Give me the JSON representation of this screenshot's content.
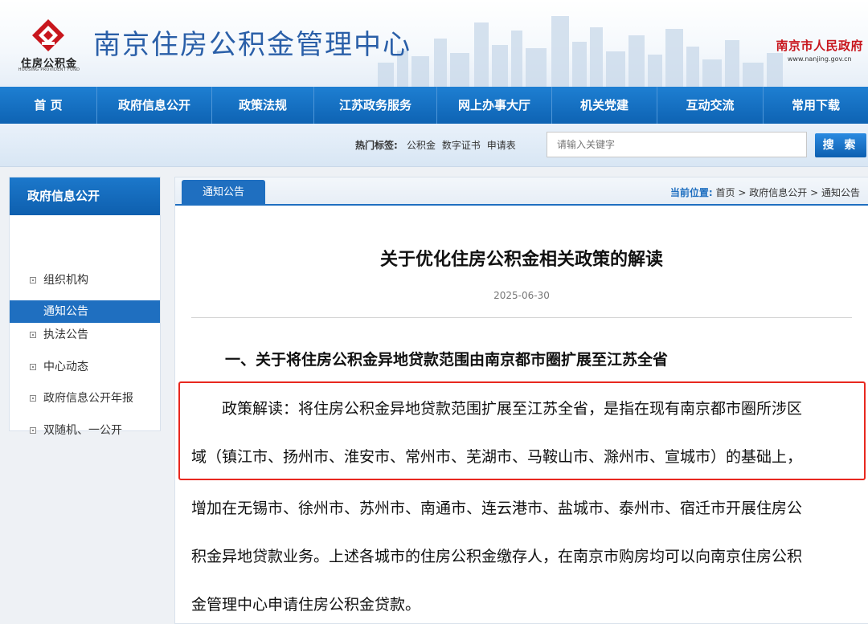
{
  "header": {
    "logo_text": "住房公积金",
    "logo_sub": "HOUSING PROVIDENT FUND",
    "site_title": "南京住房公积金管理中心",
    "gov_name": "南京市人民政府",
    "gov_url": "www.nanjing.gov.cn",
    "brand_color": "#c8161d"
  },
  "nav": {
    "items": [
      {
        "label": "首 页"
      },
      {
        "label": "政府信息公开"
      },
      {
        "label": "政策法规"
      },
      {
        "label": "江苏政务服务"
      },
      {
        "label": "网上办事大厅"
      },
      {
        "label": "机关党建"
      },
      {
        "label": "互动交流"
      },
      {
        "label": "常用下载"
      }
    ],
    "color": "#1170c4"
  },
  "search": {
    "hot_label": "热门标签:",
    "tags": [
      "公积金",
      "数字证书",
      "申请表"
    ],
    "placeholder": "请输入关键字",
    "button": "搜 索"
  },
  "sidebar": {
    "title": "政府信息公开",
    "items": [
      {
        "label": "组织机构",
        "active": false
      },
      {
        "label": "通知公告",
        "active": true
      },
      {
        "label": "执法公告",
        "active": false
      },
      {
        "label": "中心动态",
        "active": false
      },
      {
        "label": "政府信息公开年报",
        "active": false
      },
      {
        "label": "双随机、一公开",
        "active": false
      }
    ]
  },
  "main": {
    "tab": "通知公告",
    "breadcrumb_label": "当前位置:",
    "breadcrumb": [
      "首页",
      "政府信息公开",
      "通知公告"
    ],
    "breadcrumb_sep": ">",
    "title": "关于优化住房公积金相关政策的解读",
    "date": "2025-06-30",
    "section_heading": "一、关于将住房公积金异地贷款范围由南京都市圈扩展至江苏全省",
    "lines": [
      "　　政策解读：将住房公积金异地贷款范围扩展至江苏全省，是指在现有南京都市圈所涉区",
      "域（镇江市、扬州市、淮安市、常州市、芜湖市、马鞍山市、滁州市、宣城市）的基础上，",
      "增加在无锡市、徐州市、苏州市、南通市、连云港市、盐城市、泰州市、宿迁市开展住房公",
      "积金异地贷款业务。上述各城市的住房公积金缴存人，在南京市购房均可以向南京住房公积",
      "金管理中心申请住房公积金贷款。"
    ],
    "highlight_color": "#e8281f"
  }
}
